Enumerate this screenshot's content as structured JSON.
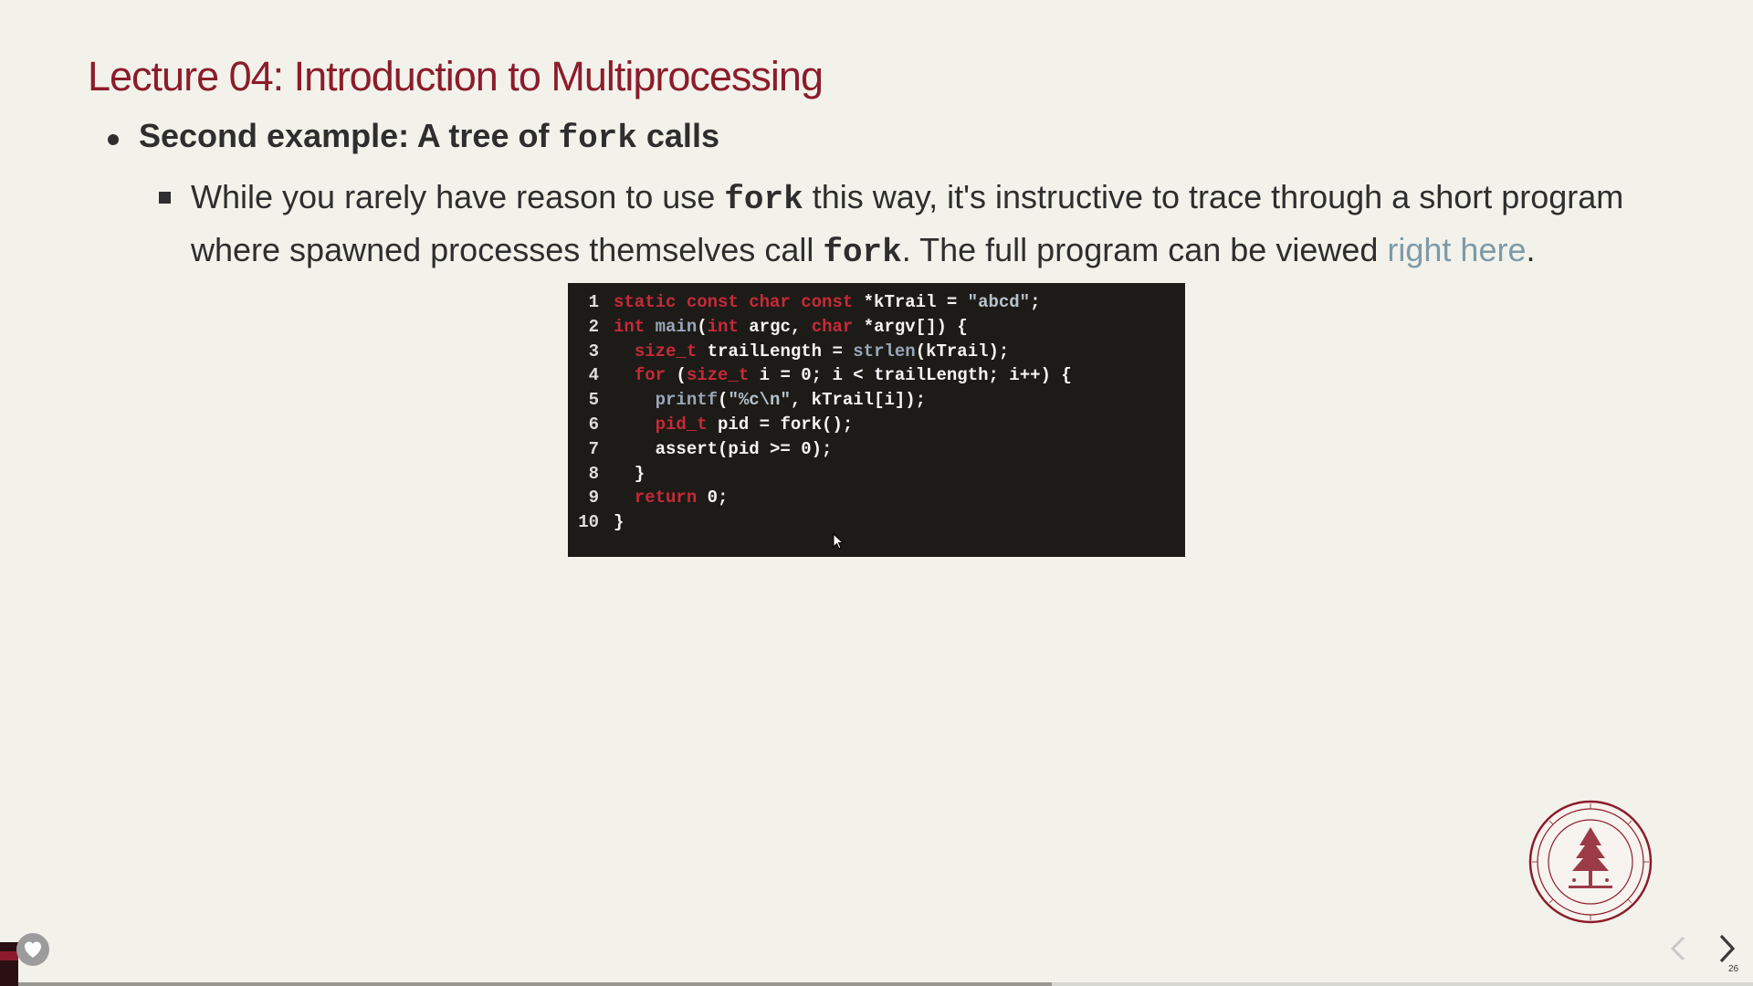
{
  "slide": {
    "title": "Lecture 04: Introduction to Multiprocessing",
    "bullet1": {
      "pre": "Second example: A tree of ",
      "code": "fork",
      "post": " calls"
    },
    "bullet2": {
      "part1": "While you rarely have reason to use ",
      "code1": "fork",
      "part2": " this way, it's instructive to trace through a short program where spawned processes themselves call ",
      "code2": "fork",
      "part3": ". The full program can be viewed ",
      "link": "right here",
      "part4": "."
    },
    "code_lines": [
      {
        "num": "1",
        "tokens": [
          {
            "t": "static const char const",
            "c": "kw"
          },
          {
            "t": " *kTrail = ",
            "c": ""
          },
          {
            "t": "\"abcd\"",
            "c": "str"
          },
          {
            "t": ";",
            "c": ""
          }
        ]
      },
      {
        "num": "2",
        "tokens": [
          {
            "t": "int",
            "c": "kw"
          },
          {
            "t": " ",
            "c": ""
          },
          {
            "t": "main",
            "c": "fn"
          },
          {
            "t": "(",
            "c": ""
          },
          {
            "t": "int",
            "c": "kw"
          },
          {
            "t": " argc, ",
            "c": ""
          },
          {
            "t": "char",
            "c": "kw"
          },
          {
            "t": " *argv[]) {",
            "c": ""
          }
        ]
      },
      {
        "num": "3",
        "tokens": [
          {
            "t": "  ",
            "c": ""
          },
          {
            "t": "size_t",
            "c": "kw"
          },
          {
            "t": " trailLength = ",
            "c": ""
          },
          {
            "t": "strlen",
            "c": "fn"
          },
          {
            "t": "(kTrail);",
            "c": ""
          }
        ]
      },
      {
        "num": "4",
        "tokens": [
          {
            "t": "  ",
            "c": ""
          },
          {
            "t": "for",
            "c": "kw"
          },
          {
            "t": " (",
            "c": ""
          },
          {
            "t": "size_t",
            "c": "kw"
          },
          {
            "t": " i = 0; i < trailLength; i++) {",
            "c": ""
          }
        ]
      },
      {
        "num": "5",
        "tokens": [
          {
            "t": "    ",
            "c": ""
          },
          {
            "t": "printf",
            "c": "fn"
          },
          {
            "t": "(",
            "c": ""
          },
          {
            "t": "\"%c\\n\"",
            "c": "str"
          },
          {
            "t": ", kTrail[i]);",
            "c": ""
          }
        ]
      },
      {
        "num": "6",
        "tokens": [
          {
            "t": "    ",
            "c": ""
          },
          {
            "t": "pid_t",
            "c": "kw"
          },
          {
            "t": " pid = fork();",
            "c": ""
          }
        ]
      },
      {
        "num": "7",
        "tokens": [
          {
            "t": "    assert(pid >= 0);",
            "c": ""
          }
        ]
      },
      {
        "num": "8",
        "tokens": [
          {
            "t": "  }",
            "c": ""
          }
        ]
      },
      {
        "num": "9",
        "tokens": [
          {
            "t": "  ",
            "c": ""
          },
          {
            "t": "return",
            "c": "kw"
          },
          {
            "t": " 0;",
            "c": ""
          }
        ]
      },
      {
        "num": "10",
        "tokens": [
          {
            "t": "}",
            "c": ""
          }
        ]
      }
    ],
    "page_number": "26",
    "progress_fraction": 0.6
  },
  "colors": {
    "title": "#8c1c2b",
    "link": "#7d9aa8",
    "keyword": "#c52a38",
    "background": "#f2f2eb",
    "code_bg": "#1d1b17"
  },
  "icons": {
    "seal": "university-seal-icon",
    "prev": "chevron-left-icon",
    "next": "chevron-right-icon",
    "heart": "heart-icon",
    "cursor": "mouse-cursor-icon"
  }
}
